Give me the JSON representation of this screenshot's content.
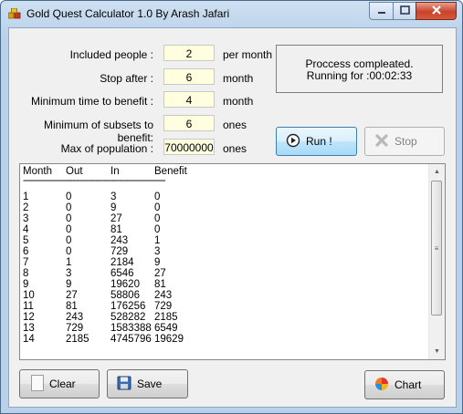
{
  "window": {
    "title": "Gold Quest Calculator 1.0 By Arash Jafari"
  },
  "settings": [
    {
      "label": "Included people :",
      "value": "2",
      "unit": "per month"
    },
    {
      "label": "Stop after :",
      "value": "6",
      "unit": "month"
    },
    {
      "label": "Minimum time to benefit :",
      "value": "4",
      "unit": "month"
    },
    {
      "label": "Minimum of subsets to benefit:",
      "value": "6",
      "unit": "ones"
    },
    {
      "label": "Max of population :",
      "value": "70000000",
      "unit": "ones"
    }
  ],
  "status": {
    "line1": "Proccess compleated.",
    "line2": "Running for :00:02:33"
  },
  "buttons": {
    "run": "Run !",
    "stop": "Stop",
    "clear": "Clear",
    "save": "Save",
    "chart": "Chart"
  },
  "results": {
    "headers": [
      "Month",
      "Out",
      "In",
      "Benefit"
    ],
    "separator": "-------------------------------------------------------",
    "rows": [
      [
        "1",
        "0",
        "3",
        "0"
      ],
      [
        "2",
        "0",
        "9",
        "0"
      ],
      [
        "3",
        "0",
        "27",
        "0"
      ],
      [
        "4",
        "0",
        "81",
        "0"
      ],
      [
        "5",
        "0",
        "243",
        "1"
      ],
      [
        "6",
        "0",
        "729",
        "3"
      ],
      [
        "7",
        "1",
        "2184",
        "9"
      ],
      [
        "8",
        "3",
        "6546",
        "27"
      ],
      [
        "9",
        "9",
        "19620",
        "81"
      ],
      [
        "10",
        "27",
        "58806",
        "243"
      ],
      [
        "11",
        "81",
        "176256",
        "729"
      ],
      [
        "12",
        "243",
        "528282",
        "2185"
      ],
      [
        "13",
        "729",
        "1583388",
        "6549"
      ],
      [
        "14",
        "2185",
        "4745796",
        "19629"
      ]
    ]
  },
  "icons": {
    "app": "gold-bars-icon",
    "run": "play-icon",
    "stop": "stop-cross-icon",
    "clear": "blank-page-icon",
    "save": "floppy-disk-icon",
    "chart": "pie-chart-icon"
  }
}
